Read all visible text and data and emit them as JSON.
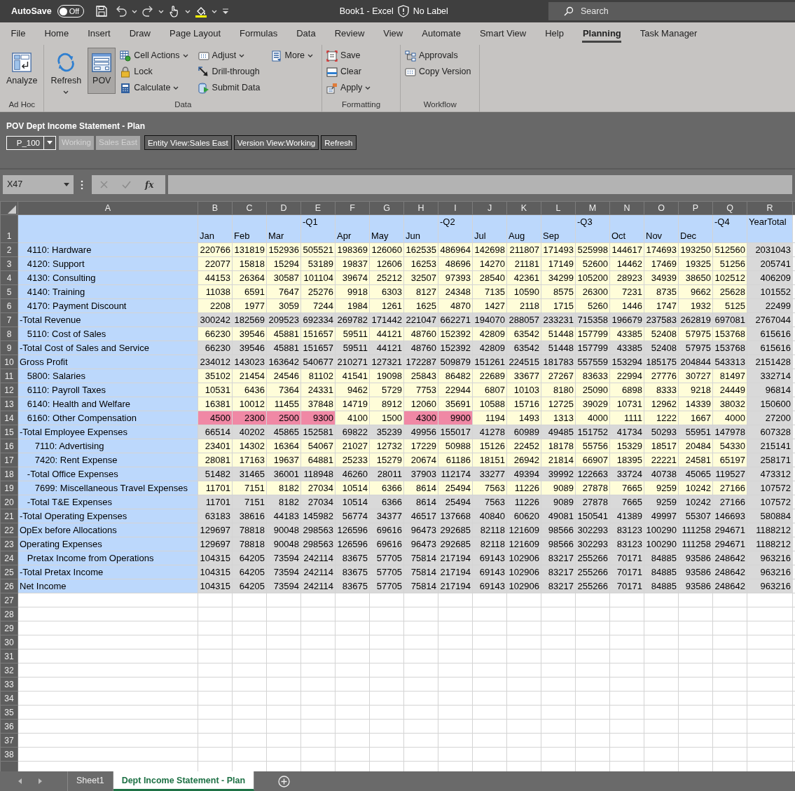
{
  "title_bar": {
    "autosave_label": "AutoSave",
    "autosave_toggle": {
      "text": "Off",
      "on": false
    },
    "title": "Book1  -  Excel",
    "sensitivity": "No Label",
    "search_placeholder": "Search"
  },
  "tabs": [
    {
      "label": "File",
      "selected": false
    },
    {
      "label": "Home",
      "selected": false
    },
    {
      "label": "Insert",
      "selected": false
    },
    {
      "label": "Draw",
      "selected": false
    },
    {
      "label": "Page Layout",
      "selected": false
    },
    {
      "label": "Formulas",
      "selected": false
    },
    {
      "label": "Data",
      "selected": false
    },
    {
      "label": "Review",
      "selected": false
    },
    {
      "label": "View",
      "selected": false
    },
    {
      "label": "Automate",
      "selected": false
    },
    {
      "label": "Smart View",
      "selected": false
    },
    {
      "label": "Help",
      "selected": false
    },
    {
      "label": "Planning",
      "selected": true
    },
    {
      "label": "Task Manager",
      "selected": false
    }
  ],
  "ribbon": {
    "groups": [
      {
        "label": "Ad Hoc",
        "large": [
          {
            "label": "Analyze",
            "menu": false,
            "selected": false
          }
        ]
      },
      {
        "label": "Data",
        "large": [
          {
            "label": "Refresh",
            "menu": true,
            "selected": false
          },
          {
            "label": "POV",
            "menu": false,
            "selected": true
          }
        ],
        "small": [
          [
            {
              "label": "Cell Actions",
              "menu": true
            },
            {
              "label": "Lock",
              "menu": false
            },
            {
              "label": "Calculate",
              "menu": true
            }
          ],
          [
            {
              "label": "Adjust",
              "menu": true
            },
            {
              "label": "Drill-through",
              "menu": false
            },
            {
              "label": "Submit Data",
              "menu": false
            }
          ],
          [
            {
              "label": "More",
              "menu": true
            }
          ]
        ]
      },
      {
        "label": "Formatting",
        "small": [
          [
            {
              "label": "Save",
              "menu": false
            },
            {
              "label": "Clear",
              "menu": false
            },
            {
              "label": "Apply",
              "menu": true
            }
          ]
        ]
      },
      {
        "label": "Workflow",
        "small": [
          [
            {
              "label": "Approvals",
              "menu": false
            },
            {
              "label": "Copy Version",
              "menu": false
            }
          ]
        ]
      }
    ]
  },
  "pov": {
    "title": "POV Dept Income Statement - Plan",
    "dropdown": "P_100",
    "fields": [
      {
        "text": "Working",
        "disabled": true
      },
      {
        "text": "Sales East",
        "disabled": true
      }
    ],
    "buttons": [
      "Entity View:Sales East",
      "Version View:Working",
      "Refresh"
    ]
  },
  "formula_bar": {
    "name_box": "X47",
    "function_label": "fx"
  },
  "columns": [
    {
      "letter": "A",
      "shaded": false
    },
    {
      "letter": "B",
      "heading_bottom": "Jan",
      "shaded": false
    },
    {
      "letter": "C",
      "heading_bottom": "Feb",
      "shaded": false
    },
    {
      "letter": "D",
      "heading_bottom": "Mar",
      "shaded": false
    },
    {
      "letter": "E",
      "heading_top": "-Q1",
      "shaded": false
    },
    {
      "letter": "F",
      "heading_bottom": "Apr",
      "shaded": false
    },
    {
      "letter": "G",
      "heading_bottom": "May",
      "shaded": false
    },
    {
      "letter": "H",
      "heading_bottom": "Jun",
      "shaded": false
    },
    {
      "letter": "I",
      "heading_top": "-Q2",
      "shaded": false
    },
    {
      "letter": "J",
      "heading_bottom": "Jul",
      "shaded": false
    },
    {
      "letter": "K",
      "heading_bottom": "Aug",
      "shaded": false
    },
    {
      "letter": "L",
      "heading_bottom": "Sep",
      "shaded": false
    },
    {
      "letter": "M",
      "heading_top": "-Q3",
      "shaded": false
    },
    {
      "letter": "N",
      "heading_bottom": "Oct",
      "shaded": false
    },
    {
      "letter": "O",
      "heading_bottom": "Nov",
      "shaded": false
    },
    {
      "letter": "P",
      "heading_bottom": "Dec",
      "shaded": false
    },
    {
      "letter": "Q",
      "heading_top": "-Q4",
      "shaded": false
    },
    {
      "letter": "R",
      "heading_top": "YearTotal",
      "shaded": true
    }
  ],
  "header_row_number": "1",
  "rows": [
    {
      "number": "2",
      "label": "   4110: Hardware",
      "kind": "input",
      "values": [
        "220766",
        "131819",
        "152936",
        "505521",
        "198369",
        "126060",
        "162535",
        "486964",
        "142698",
        "211807",
        "171493",
        "525998",
        "144617",
        "174693",
        "193250",
        "512560",
        "2031043"
      ]
    },
    {
      "number": "3",
      "label": "   4120: Support",
      "kind": "input",
      "values": [
        "22077",
        "15818",
        "15294",
        "53189",
        "19837",
        "12606",
        "16253",
        "48696",
        "14270",
        "21181",
        "17149",
        "52600",
        "14462",
        "17469",
        "19325",
        "51256",
        "205741"
      ]
    },
    {
      "number": "4",
      "label": "   4130: Consulting",
      "kind": "input",
      "values": [
        "44153",
        "26364",
        "30587",
        "101104",
        "39674",
        "25212",
        "32507",
        "97393",
        "28540",
        "42361",
        "34299",
        "105200",
        "28923",
        "34939",
        "38650",
        "102512",
        "406209"
      ]
    },
    {
      "number": "5",
      "label": "   4140: Training",
      "kind": "input",
      "values": [
        "11038",
        "6591",
        "7647",
        "25276",
        "9918",
        "6303",
        "8127",
        "24348",
        "7135",
        "10590",
        "8575",
        "26300",
        "7231",
        "8735",
        "9662",
        "25628",
        "101552"
      ]
    },
    {
      "number": "6",
      "label": "   4170: Payment Discount",
      "kind": "input",
      "values": [
        "2208",
        "1977",
        "3059",
        "7244",
        "1984",
        "1261",
        "1625",
        "4870",
        "1427",
        "2118",
        "1715",
        "5260",
        "1446",
        "1747",
        "1932",
        "5125",
        "22499"
      ]
    },
    {
      "number": "7",
      "label": "-Total Revenue",
      "kind": "total",
      "values": [
        "300242",
        "182569",
        "209523",
        "692334",
        "269782",
        "171442",
        "221047",
        "662271",
        "194070",
        "288057",
        "233231",
        "715358",
        "196679",
        "237583",
        "262819",
        "697081",
        "2767044"
      ]
    },
    {
      "number": "8",
      "label": "   5110: Cost of Sales",
      "kind": "input",
      "values": [
        "66230",
        "39546",
        "45881",
        "151657",
        "59511",
        "44121",
        "48760",
        "152392",
        "42809",
        "63542",
        "51448",
        "157799",
        "43385",
        "52408",
        "57975",
        "153768",
        "615616"
      ]
    },
    {
      "number": "9",
      "label": "-Total Cost of Sales and Service",
      "kind": "total",
      "values": [
        "66230",
        "39546",
        "45881",
        "151657",
        "59511",
        "44121",
        "48760",
        "152392",
        "42809",
        "63542",
        "51448",
        "157799",
        "43385",
        "52408",
        "57975",
        "153768",
        "615616"
      ]
    },
    {
      "number": "10",
      "label": "Gross Profit",
      "kind": "total",
      "values": [
        "234012",
        "143023",
        "163642",
        "540677",
        "210271",
        "127321",
        "172287",
        "509879",
        "151261",
        "224515",
        "181783",
        "557559",
        "153294",
        "185175",
        "204844",
        "543313",
        "2151428"
      ]
    },
    {
      "number": "11",
      "label": "   5800: Salaries",
      "kind": "input",
      "values": [
        "35102",
        "21454",
        "24546",
        "81102",
        "41541",
        "19098",
        "25843",
        "86482",
        "22689",
        "33677",
        "27267",
        "83633",
        "22994",
        "27776",
        "30727",
        "81497",
        "332714"
      ]
    },
    {
      "number": "12",
      "label": "   6110: Payroll Taxes",
      "kind": "input",
      "values": [
        "10531",
        "6436",
        "7364",
        "24331",
        "9462",
        "5729",
        "7753",
        "22944",
        "6807",
        "10103",
        "8180",
        "25090",
        "6898",
        "8333",
        "9218",
        "24449",
        "96814"
      ]
    },
    {
      "number": "13",
      "label": "   6140: Health and Welfare",
      "kind": "input",
      "values": [
        "16381",
        "10012",
        "11455",
        "37848",
        "14719",
        "8912",
        "12060",
        "35691",
        "10588",
        "15716",
        "12725",
        "39029",
        "10731",
        "12962",
        "14339",
        "38032",
        "150600"
      ]
    },
    {
      "number": "14",
      "label": "   6160: Other Compensation",
      "kind": "input",
      "values": [
        "4500",
        "2300",
        "2500",
        "9300",
        "4100",
        "1500",
        "4300",
        "9900",
        "1194",
        "1493",
        "1313",
        "4000",
        "1111",
        "1222",
        "1667",
        "4000",
        "27200"
      ],
      "modified": [
        true,
        true,
        true,
        true,
        false,
        false,
        true,
        true,
        false,
        false,
        false,
        false,
        false,
        false,
        false,
        false,
        false
      ]
    },
    {
      "number": "15",
      "label": "-Total Employee Expenses",
      "kind": "total",
      "values": [
        "66514",
        "40202",
        "45865",
        "152581",
        "69822",
        "35239",
        "49956",
        "155017",
        "41278",
        "60989",
        "49485",
        "151752",
        "41734",
        "50293",
        "55951",
        "147978",
        "607328"
      ]
    },
    {
      "number": "16",
      "label": "      7110: Advertising",
      "kind": "input",
      "values": [
        "23401",
        "14302",
        "16364",
        "54067",
        "21027",
        "12732",
        "17229",
        "50988",
        "15126",
        "22452",
        "18178",
        "55756",
        "15329",
        "18517",
        "20484",
        "54330",
        "215141"
      ]
    },
    {
      "number": "17",
      "label": "      7420: Rent Expense",
      "kind": "input",
      "values": [
        "28081",
        "17163",
        "19637",
        "64881",
        "25233",
        "15279",
        "20674",
        "61186",
        "18151",
        "26942",
        "21814",
        "66907",
        "18395",
        "22221",
        "24581",
        "65197",
        "258171"
      ]
    },
    {
      "number": "18",
      "label": "   -Total Office Expenses",
      "kind": "total",
      "values": [
        "51482",
        "31465",
        "36001",
        "118948",
        "46260",
        "28011",
        "37903",
        "112174",
        "33277",
        "49394",
        "39992",
        "122663",
        "33724",
        "40738",
        "45065",
        "119527",
        "473312"
      ]
    },
    {
      "number": "19",
      "label": "      7699: Miscellaneous Travel Expenses",
      "kind": "input",
      "values": [
        "11701",
        "7151",
        "8182",
        "27034",
        "10514",
        "6366",
        "8614",
        "25494",
        "7563",
        "11226",
        "9089",
        "27878",
        "7665",
        "9259",
        "10242",
        "27166",
        "107572"
      ]
    },
    {
      "number": "20",
      "label": "   -Total T&E Expenses",
      "kind": "total",
      "values": [
        "11701",
        "7151",
        "8182",
        "27034",
        "10514",
        "6366",
        "8614",
        "25494",
        "7563",
        "11226",
        "9089",
        "27878",
        "7665",
        "9259",
        "10242",
        "27166",
        "107572"
      ]
    },
    {
      "number": "21",
      "label": "-Total Operating Expenses",
      "kind": "total",
      "values": [
        "63183",
        "38616",
        "44183",
        "145982",
        "56774",
        "34377",
        "46517",
        "137668",
        "40840",
        "60620",
        "49081",
        "150541",
        "41389",
        "49997",
        "55307",
        "146693",
        "580884"
      ]
    },
    {
      "number": "22",
      "label": "OpEx before Allocations",
      "kind": "total",
      "values": [
        "129697",
        "78818",
        "90048",
        "298563",
        "126596",
        "69616",
        "96473",
        "292685",
        "82118",
        "121609",
        "98566",
        "302293",
        "83123",
        "100290",
        "111258",
        "294671",
        "1188212"
      ]
    },
    {
      "number": "23",
      "label": "Operating Expenses",
      "kind": "total",
      "values": [
        "129697",
        "78818",
        "90048",
        "298563",
        "126596",
        "69616",
        "96473",
        "292685",
        "82118",
        "121609",
        "98566",
        "302293",
        "83123",
        "100290",
        "111258",
        "294671",
        "1188212"
      ]
    },
    {
      "number": "24",
      "label": "   Pretax Income from Operations",
      "kind": "total",
      "values": [
        "104315",
        "64205",
        "73594",
        "242114",
        "83675",
        "57705",
        "75814",
        "217194",
        "69143",
        "102906",
        "83217",
        "255266",
        "70171",
        "84885",
        "93586",
        "248642",
        "963216"
      ]
    },
    {
      "number": "25",
      "label": "-Total Pretax Income",
      "kind": "total",
      "values": [
        "104315",
        "64205",
        "73594",
        "242114",
        "83675",
        "57705",
        "75814",
        "217194",
        "69143",
        "102906",
        "83217",
        "255266",
        "70171",
        "84885",
        "93586",
        "248642",
        "963216"
      ]
    },
    {
      "number": "26",
      "label": "Net Income",
      "kind": "total",
      "values": [
        "104315",
        "64205",
        "73594",
        "242114",
        "83675",
        "57705",
        "75814",
        "217194",
        "69143",
        "102906",
        "83217",
        "255266",
        "70171",
        "84885",
        "93586",
        "248642",
        "963216"
      ]
    }
  ],
  "empty_rows": [
    "27",
    "28",
    "29",
    "30",
    "31",
    "32",
    "33",
    "34",
    "35",
    "36",
    "37",
    "38"
  ],
  "sheet_tabs": [
    {
      "label": "Sheet1",
      "selected": false
    },
    {
      "label": "Dept Income Statement - Plan",
      "selected": true
    }
  ]
}
